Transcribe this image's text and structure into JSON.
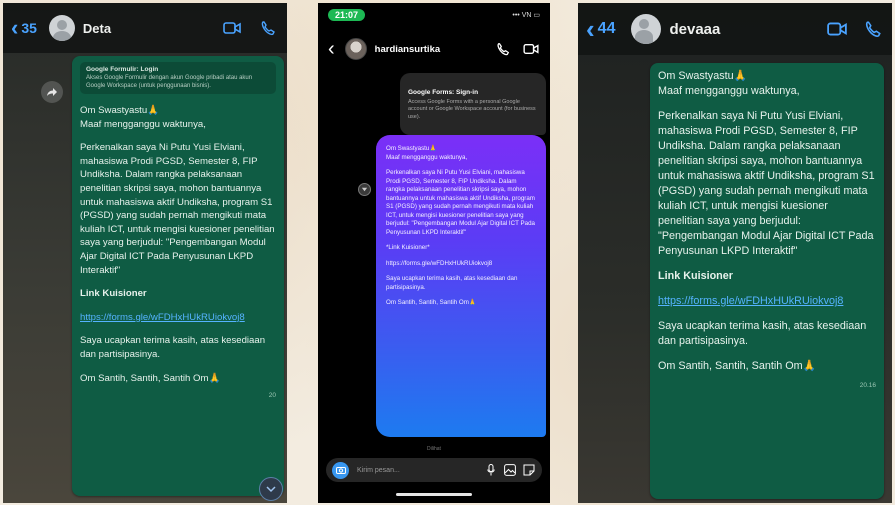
{
  "screen1": {
    "back_count": "35",
    "contact_name": "Deta",
    "preview_title": "Google Formulir: Login",
    "preview_text": "Akses Google Formulir dengan akun Google pribadi atau akun Google Workspace (untuk penggunaan bisnis).",
    "greeting": "Om Swastyastu🙏\nMaaf mengganggu waktunya,",
    "intro": "Perkenalkan saya Ni Putu Yusi Elviani, mahasiswa Prodi PGSD, Semester 8, FIP Undiksha. Dalam rangka pelaksanaan penelitian skripsi saya, mohon bantuannya untuk mahasiswa aktif Undiksha, program S1 (PGSD) yang sudah pernah mengikuti mata kuliah ICT, untuk mengisi kuesioner penelitian saya yang berjudul: \"Pengembangan Modul Ajar Digital ICT Pada Penyusunan LKPD Interaktif\"",
    "link_heading": "Link Kuisioner",
    "link_url": "https://forms.gle/wFDHxHUkRUiokvoj8",
    "thanks": "Saya ucapkan terima kasih, atas kesediaan dan partisipasinya.",
    "closing": "Om Santih, Santih, Santih Om🙏",
    "timestamp": "20"
  },
  "screen2": {
    "status_time": "21:07",
    "status_right": "••• VN ▭",
    "contact_name": "hardiansurtika",
    "card_title": "Google Forms: Sign-in",
    "card_text": "Access Google Forms with a personal Google account or Google Workspace account (for business use).",
    "greeting": "Om Swastyastu🙏\nMaaf mengganggu waktunya,",
    "intro": "Perkenalkan saya Ni Putu Yusi Elviani, mahasiswa Prodi PGSD, Semester 8, FIP Undiksha. Dalam rangka pelaksanaan penelitian skripsi saya, mohon bantuannya untuk mahasiswa aktif Undiksha, program S1 (PGSD) yang sudah pernah mengikuti mata kuliah ICT, untuk mengisi kuesioner penelitian saya yang berjudul: \"Pengembangan Modul Ajar Digital ICT Pada Penyusunan LKPD Interaktif\"",
    "link_heading": "*Link Kuisioner*",
    "link_url": "https://forms.gle/wFDHxHUkRUiokvoj8",
    "thanks": "Saya ucapkan terima kasih, atas kesediaan dan partisipasinya.",
    "closing": "Om Santih, Santih, Santih Om🙏",
    "seen": "Dilihat",
    "composer_placeholder": "Kirim pesan..."
  },
  "screen3": {
    "back_count": "44",
    "contact_name": "devaaa",
    "greeting": "Om Swastyastu🙏\nMaaf mengganggu waktunya,",
    "intro": "Perkenalkan saya Ni Putu Yusi Elviani, mahasiswa Prodi PGSD, Semester 8, FIP Undiksha. Dalam rangka pelaksanaan penelitian skripsi saya, mohon bantuannya untuk mahasiswa aktif Undiksha, program S1 (PGSD) yang sudah pernah mengikuti mata kuliah ICT, untuk mengisi kuesioner penelitian saya yang berjudul: \"Pengembangan Modul Ajar Digital ICT Pada Penyusunan LKPD Interaktif\"",
    "link_heading": "Link Kuisioner",
    "link_url": "https://forms.gle/wFDHxHUkRUiokvoj8",
    "thanks": "Saya ucapkan terima kasih, atas kesediaan dan partisipasinya.",
    "closing": "Om Santih, Santih, Santih Om🙏",
    "timestamp": "20.16"
  },
  "colors": {
    "wa_bubble": "#0f5c44",
    "wa_link": "#55b3ff",
    "ios_blue": "#4aa3ff",
    "ig_gradient_top": "#7b2ff7",
    "ig_gradient_bottom": "#1d7bf0"
  },
  "icons": [
    "chevron-left-icon",
    "video-call-icon",
    "phone-icon",
    "forward-icon",
    "scroll-down-icon",
    "camera-icon",
    "mic-icon",
    "gallery-icon",
    "sticker-icon"
  ]
}
